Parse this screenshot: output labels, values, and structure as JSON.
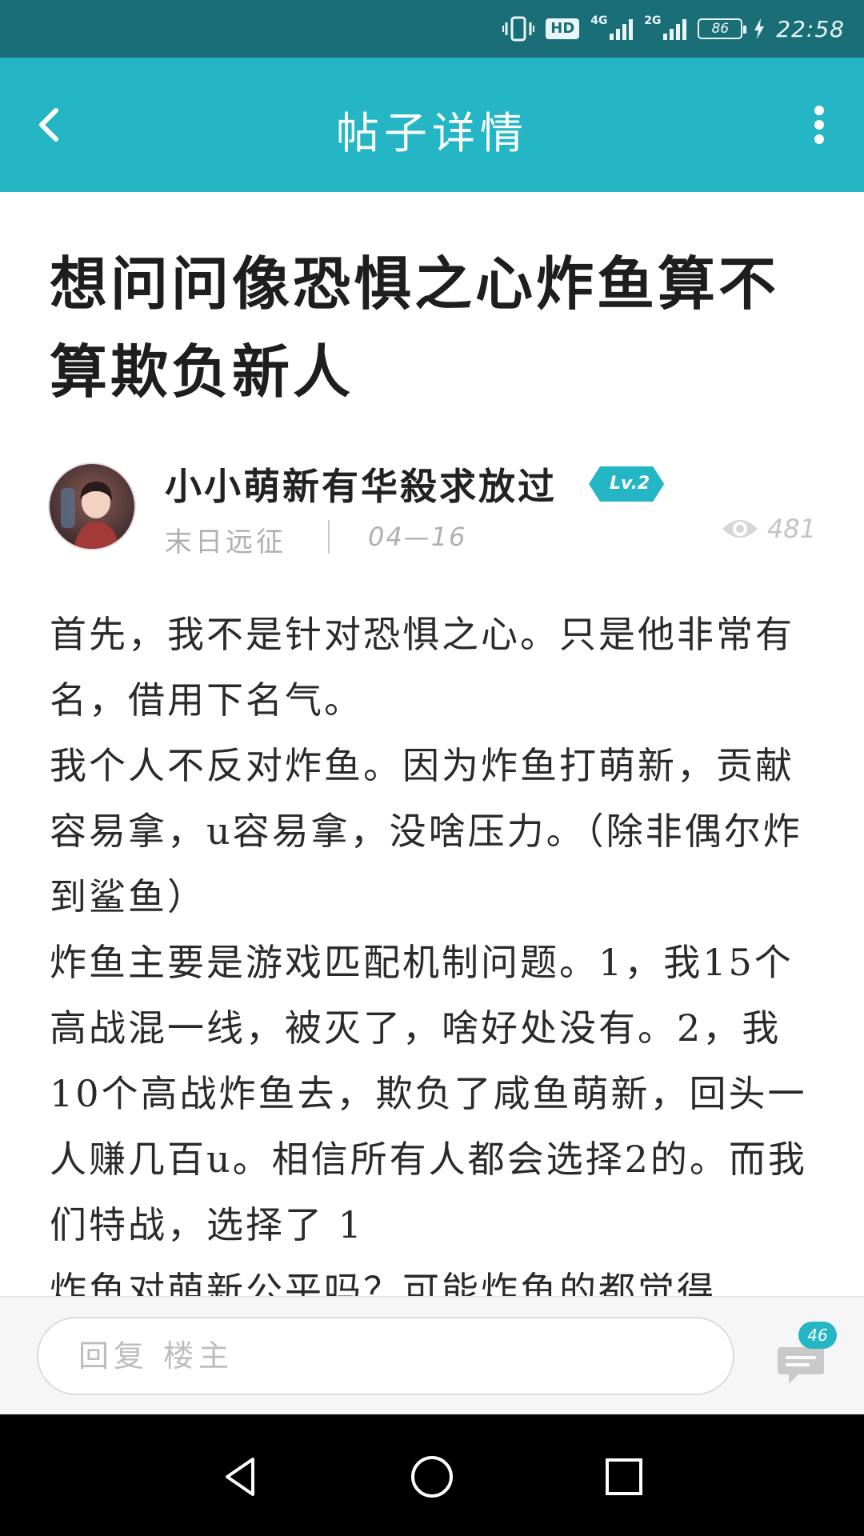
{
  "status_bar": {
    "hd_label": "HD",
    "network_1": "4G",
    "network_2": "2G",
    "battery": "86",
    "time": "22:58"
  },
  "header": {
    "title": "帖子详情"
  },
  "post": {
    "title": "想问问像恐惧之心炸鱼算不算欺负新人",
    "author": {
      "name": "小小萌新有华殺求放过",
      "level": "Lv.2"
    },
    "category": "末日远征",
    "date": "04—16",
    "views": "481",
    "body": [
      "首先，我不是针对恐惧之心。只是他非常有名，借用下名气。",
      "我个人不反对炸鱼。因为炸鱼打萌新，贡献容易拿，u容易拿，没啥压力。（除非偶尔炸到鲨鱼）",
      "炸鱼主要是游戏匹配机制问题。1，我15个高战混一线，被灭了，啥好处没有。2，我10个高战炸鱼去，欺负了咸鱼萌新，回头一人赚几百u。相信所有人都会选择2的。而我们特战，选择了 1",
      "炸鱼对萌新公平吗？可能炸鱼的都觉得"
    ]
  },
  "reply_bar": {
    "placeholder": "回复   楼主",
    "comment_count": "46"
  }
}
